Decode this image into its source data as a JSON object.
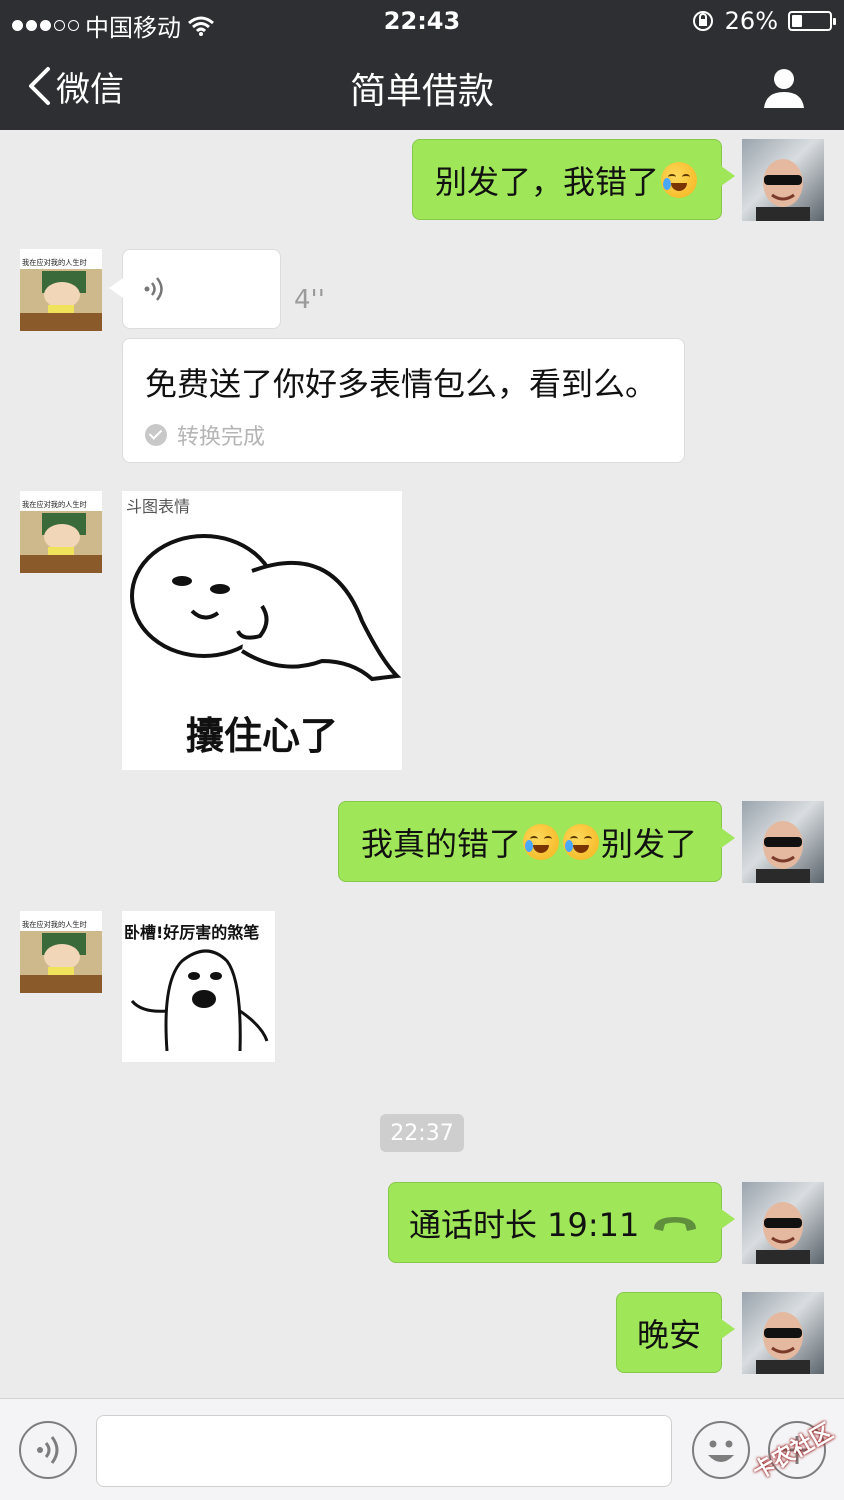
{
  "status_bar": {
    "carrier": "中国移动",
    "time": "22:43",
    "battery_percent": "26%",
    "battery_level": 0.26,
    "signal_bars_filled": 3,
    "signal_bars_total": 5,
    "icons": [
      "signal-dots-icon",
      "wifi-icon",
      "rotation-lock-icon",
      "battery-icon"
    ]
  },
  "nav": {
    "back_label": "微信",
    "title": "简单借款",
    "back_icon": "chevron-left-icon",
    "profile_icon": "person-icon"
  },
  "messages": [
    {
      "type": "text",
      "sender": "me",
      "text_parts": [
        "别发了，我错了"
      ],
      "emoji_after": 1
    },
    {
      "type": "voice",
      "sender": "friend",
      "duration": "4''",
      "transcript": "免费送了你好多表情包么，看到么。",
      "status": "转换完成"
    },
    {
      "type": "sticker",
      "sender": "friend",
      "watermark": "斗图表情",
      "caption": "攮住心了"
    },
    {
      "type": "text",
      "sender": "me",
      "prefix": "我真的错了",
      "suffix": "别发了",
      "emoji_count": 2
    },
    {
      "type": "sticker",
      "sender": "friend",
      "caption": "卧槽!好厉害的煞笔"
    },
    {
      "type": "timestamp",
      "text": "22:37"
    },
    {
      "type": "call",
      "sender": "me",
      "text": "通话时长 19:11",
      "icon": "phone-hangup-icon"
    },
    {
      "type": "text",
      "sender": "me",
      "text_parts": [
        "晚安"
      ]
    }
  ],
  "friend_avatar_caption": "我在应对我的人生时",
  "input_bar": {
    "voice_icon": "voice-icon",
    "emoji_icon": "smiley-icon",
    "plus_icon": "plus-icon",
    "watermark": "卡农社区"
  },
  "colors": {
    "header_bg": "#2e2f33",
    "chat_bg": "#ebebeb",
    "bubble_me": "#9fe658",
    "bubble_friend": "#ffffff",
    "call_icon": "#5f8f3c"
  }
}
